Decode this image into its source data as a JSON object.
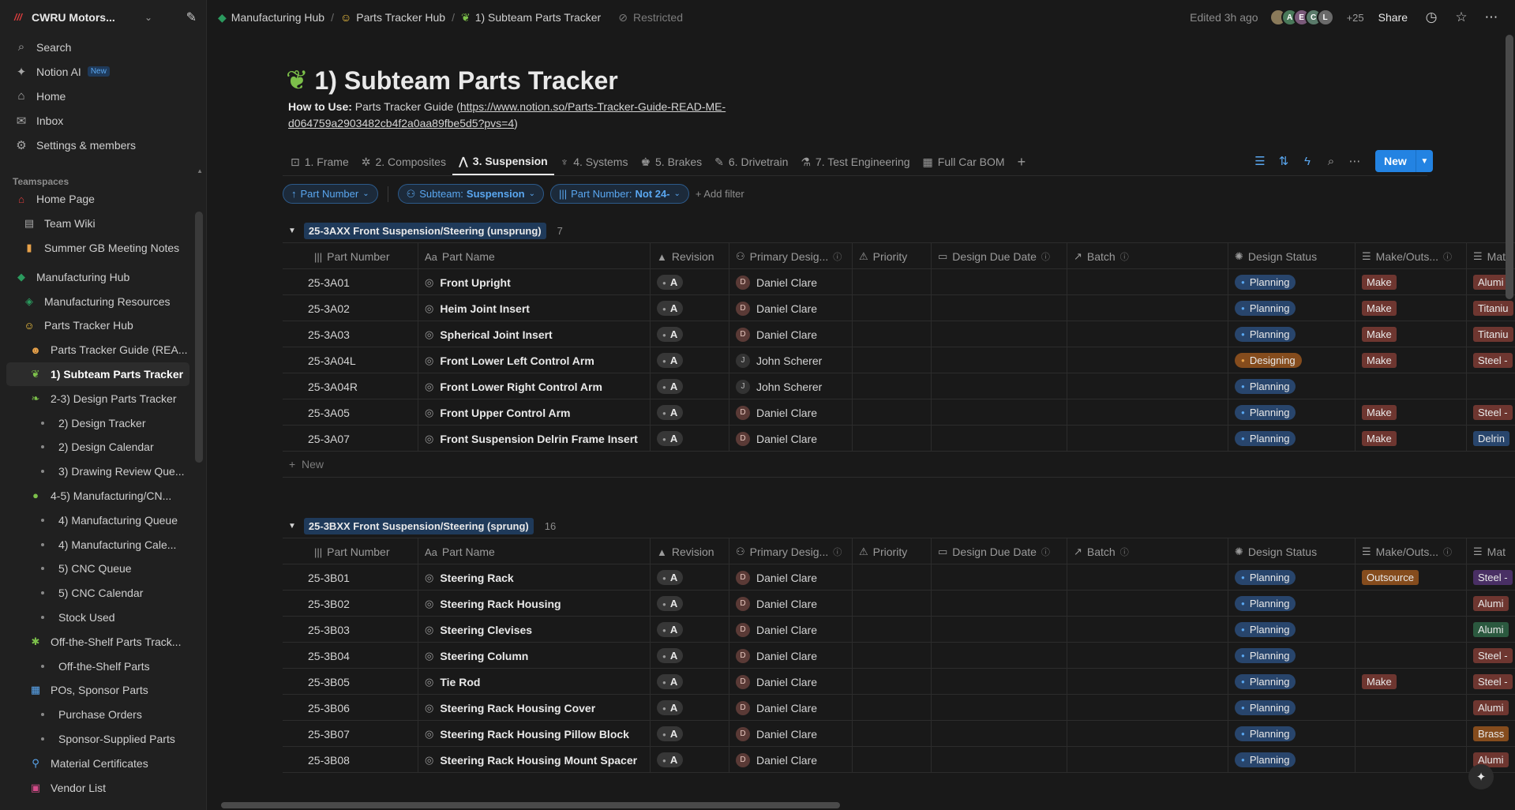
{
  "workspace": {
    "name": "CWRU Motors...",
    "logo": "///"
  },
  "sidebar": {
    "nav": [
      {
        "icon": "search-icon",
        "glyph": "⌕",
        "label": "Search"
      },
      {
        "icon": "notion-ai-icon",
        "glyph": "✦",
        "label": "Notion AI",
        "badge": "New"
      },
      {
        "icon": "home-icon",
        "glyph": "⌂",
        "label": "Home"
      },
      {
        "icon": "inbox-icon",
        "glyph": "✉",
        "label": "Inbox"
      },
      {
        "icon": "gear-icon",
        "glyph": "⚙",
        "label": "Settings & members"
      }
    ],
    "teamspaces_label": "Teamspaces",
    "tree": [
      {
        "label": "Home Page",
        "glyph": "⌂",
        "indent": 0,
        "color": "#e03e3e"
      },
      {
        "label": "Team Wiki",
        "glyph": "▤",
        "indent": 1,
        "color": "#a6a6a6"
      },
      {
        "label": "Summer GB Meeting Notes",
        "glyph": "▮",
        "indent": 1,
        "color": "#e8a24a"
      },
      {
        "label": "Manufacturing Hub",
        "glyph": "◆",
        "indent": 0,
        "color": "#2b9a5e",
        "gap": true
      },
      {
        "label": "Manufacturing Resources",
        "glyph": "◈",
        "indent": 1,
        "color": "#2b9a5e"
      },
      {
        "label": "Parts Tracker Hub",
        "glyph": "☺",
        "indent": 1,
        "color": "#f5c542"
      },
      {
        "label": "Parts Tracker Guide (REA...",
        "glyph": "☻",
        "indent": 2,
        "color": "#e8a24a"
      },
      {
        "label": "1) Subteam Parts Tracker",
        "glyph": "❦",
        "indent": 2,
        "color": "#7cc04a",
        "active": true
      },
      {
        "label": "2-3) Design Parts Tracker",
        "glyph": "❧",
        "indent": 2,
        "color": "#7cc04a"
      },
      {
        "label": "2) Design Tracker",
        "dot": true,
        "indent": 3
      },
      {
        "label": "2) Design Calendar",
        "dot": true,
        "indent": 3
      },
      {
        "label": "3) Drawing Review Que...",
        "dot": true,
        "indent": 3
      },
      {
        "label": "4-5) Manufacturing/CN...",
        "glyph": "●",
        "indent": 2,
        "color": "#7cc04a"
      },
      {
        "label": "4) Manufacturing Queue",
        "dot": true,
        "indent": 3
      },
      {
        "label": "4) Manufacturing Cale...",
        "dot": true,
        "indent": 3
      },
      {
        "label": "5) CNC Queue",
        "dot": true,
        "indent": 3
      },
      {
        "label": "5) CNC Calendar",
        "dot": true,
        "indent": 3
      },
      {
        "label": "Stock Used",
        "dot": true,
        "indent": 3
      },
      {
        "label": "Off-the-Shelf Parts Track...",
        "glyph": "✱",
        "indent": 2,
        "color": "#7cc04a"
      },
      {
        "label": "Off-the-Shelf Parts",
        "dot": true,
        "indent": 3
      },
      {
        "label": "POs, Sponsor Parts",
        "glyph": "▦",
        "indent": 2,
        "color": "#5aa7f0"
      },
      {
        "label": "Purchase Orders",
        "dot": true,
        "indent": 3
      },
      {
        "label": "Sponsor-Supplied Parts",
        "dot": true,
        "indent": 3
      },
      {
        "label": "Material Certificates",
        "glyph": "⚲",
        "indent": 2,
        "color": "#5aa7f0"
      },
      {
        "label": "Vendor List",
        "glyph": "▣",
        "indent": 2,
        "color": "#d44c8a"
      }
    ]
  },
  "topbar": {
    "breadcrumbs": [
      {
        "label": "Manufacturing Hub",
        "glyph": "◆",
        "color": "#2b9a5e"
      },
      {
        "label": "Parts Tracker Hub",
        "glyph": "☺",
        "color": "#f5c542"
      },
      {
        "label": "1) Subteam Parts Tracker",
        "glyph": "❦",
        "color": "#7cc04a"
      }
    ],
    "restricted": "Restricted",
    "edited": "Edited 3h ago",
    "avatars": [
      {
        "letter": "",
        "color": "#8a7a5a"
      },
      {
        "letter": "A",
        "color": "#4a7a5a"
      },
      {
        "letter": "E",
        "color": "#7a5a7a"
      },
      {
        "letter": "C",
        "color": "#5a7a6a"
      },
      {
        "letter": "L",
        "color": "#6a6a6a"
      }
    ],
    "avatar_more": "+25",
    "share": "Share"
  },
  "page": {
    "title": "1) Subteam Parts Tracker",
    "howto_label": "How to Use:",
    "howto_text": "Parts Tracker Guide (",
    "howto_link": "https://www.notion.so/Parts-Tracker-Guide-READ-ME-d064759a2903482cb4f2a0aa89fbe5d5?pvs=4",
    "howto_close": ")"
  },
  "tabs": [
    {
      "label": "1. Frame",
      "glyph": "⊡"
    },
    {
      "label": "2. Composites",
      "glyph": "✲"
    },
    {
      "label": "3. Suspension",
      "glyph": "⋀",
      "active": true
    },
    {
      "label": "4. Systems",
      "glyph": "♆"
    },
    {
      "label": "5. Brakes",
      "glyph": "♚"
    },
    {
      "label": "6. Drivetrain",
      "glyph": "✎"
    },
    {
      "label": "7. Test Engineering",
      "glyph": "⚗"
    },
    {
      "label": "Full Car BOM",
      "glyph": "▦"
    }
  ],
  "new_button": "New",
  "filters": [
    {
      "glyph": "↑",
      "label": "Part Number",
      "bold": ""
    },
    {
      "glyph": "⚇",
      "label": "Subteam:",
      "bold": "Suspension"
    },
    {
      "glyph": "|||",
      "label": "Part Number:",
      "bold": "Not 24-"
    }
  ],
  "add_filter": "Add filter",
  "columns": [
    {
      "key": "num",
      "glyph": "|||",
      "label": "Part Number"
    },
    {
      "key": "name",
      "glyph": "Aa",
      "label": "Part Name"
    },
    {
      "key": "rev",
      "glyph": "▲",
      "label": "Revision"
    },
    {
      "key": "pd",
      "glyph": "⚇",
      "label": "Primary Desig...",
      "info": true
    },
    {
      "key": "pri",
      "glyph": "⚠",
      "label": "Priority"
    },
    {
      "key": "due",
      "glyph": "▭",
      "label": "Design Due Date",
      "info": true
    },
    {
      "key": "batch",
      "glyph": "↗",
      "label": "Batch",
      "info": true
    },
    {
      "key": "status",
      "glyph": "✺",
      "label": "Design Status"
    },
    {
      "key": "make",
      "glyph": "☰",
      "label": "Make/Outs...",
      "info": true
    },
    {
      "key": "mat",
      "glyph": "☰",
      "label": "Mat"
    }
  ],
  "groups": [
    {
      "label": "25-3AXX Front Suspension/Steering (unsprung)",
      "count": "7",
      "rows": [
        {
          "num": "25-3A01",
          "name": "Front Upright",
          "rev": "A",
          "pd": "Daniel Clare",
          "pd_init": "D",
          "status": "Planning",
          "make": "Make",
          "mat": "Alumi",
          "mat_cls": "mat-alum"
        },
        {
          "num": "25-3A02",
          "name": "Heim Joint Insert",
          "rev": "A",
          "pd": "Daniel Clare",
          "pd_init": "D",
          "status": "Planning",
          "make": "Make",
          "mat": "Titaniu",
          "mat_cls": "mat-tit"
        },
        {
          "num": "25-3A03",
          "name": "Spherical Joint Insert",
          "rev": "A",
          "pd": "Daniel Clare",
          "pd_init": "D",
          "status": "Planning",
          "make": "Make",
          "mat": "Titaniu",
          "mat_cls": "mat-tit"
        },
        {
          "num": "25-3A04L",
          "name": "Front Lower Left Control Arm",
          "rev": "A",
          "pd": "John Scherer",
          "pd_init": "J",
          "status": "Designing",
          "make": "Make",
          "mat": "Steel -",
          "mat_cls": "mat-steel"
        },
        {
          "num": "25-3A04R",
          "name": "Front Lower Right Control Arm",
          "rev": "A",
          "pd": "John Scherer",
          "pd_init": "J",
          "status": "Planning",
          "make": "",
          "mat": "",
          "mat_cls": ""
        },
        {
          "num": "25-3A05",
          "name": "Front Upper Control Arm",
          "rev": "A",
          "pd": "Daniel Clare",
          "pd_init": "D",
          "status": "Planning",
          "make": "Make",
          "mat": "Steel -",
          "mat_cls": "mat-steel"
        },
        {
          "num": "25-3A07",
          "name": "Front Suspension Delrin Frame Insert",
          "rev": "A",
          "pd": "Daniel Clare",
          "pd_init": "D",
          "status": "Planning",
          "make": "Make",
          "mat": "Delrin",
          "mat_cls": "mat-delrin"
        }
      ],
      "new_label": "New"
    },
    {
      "label": "25-3BXX Front Suspension/Steering (sprung)",
      "count": "16",
      "rows": [
        {
          "num": "25-3B01",
          "name": "Steering Rack",
          "rev": "A",
          "pd": "Daniel Clare",
          "pd_init": "D",
          "status": "Planning",
          "make": "Outsource",
          "mat": "Steel -",
          "mat_cls": "mat-purple"
        },
        {
          "num": "25-3B02",
          "name": "Steering Rack Housing",
          "rev": "A",
          "pd": "Daniel Clare",
          "pd_init": "D",
          "status": "Planning",
          "make": "",
          "mat": "Alumi",
          "mat_cls": "mat-alum"
        },
        {
          "num": "25-3B03",
          "name": "Steering Clevises",
          "rev": "A",
          "pd": "Daniel Clare",
          "pd_init": "D",
          "status": "Planning",
          "make": "",
          "mat": "Alumi",
          "mat_cls": "mat-green"
        },
        {
          "num": "25-3B04",
          "name": "Steering Column",
          "rev": "A",
          "pd": "Daniel Clare",
          "pd_init": "D",
          "status": "Planning",
          "make": "",
          "mat": "Steel -",
          "mat_cls": "mat-steel"
        },
        {
          "num": "25-3B05",
          "name": "Tie Rod",
          "rev": "A",
          "pd": "Daniel Clare",
          "pd_init": "D",
          "status": "Planning",
          "make": "Make",
          "mat": "Steel -",
          "mat_cls": "mat-steel"
        },
        {
          "num": "25-3B06",
          "name": "Steering Rack Housing Cover",
          "rev": "A",
          "pd": "Daniel Clare",
          "pd_init": "D",
          "status": "Planning",
          "make": "",
          "mat": "Alumi",
          "mat_cls": "mat-alum"
        },
        {
          "num": "25-3B07",
          "name": "Steering Rack Housing Pillow Block",
          "rev": "A",
          "pd": "Daniel Clare",
          "pd_init": "D",
          "status": "Planning",
          "make": "",
          "mat": "Brass",
          "mat_cls": "mat-brass"
        },
        {
          "num": "25-3B08",
          "name": "Steering Rack Housing Mount Spacer",
          "rev": "A",
          "pd": "Daniel Clare",
          "pd_init": "D",
          "status": "Planning",
          "make": "",
          "mat": "Alumi",
          "mat_cls": "mat-alum"
        }
      ]
    }
  ]
}
